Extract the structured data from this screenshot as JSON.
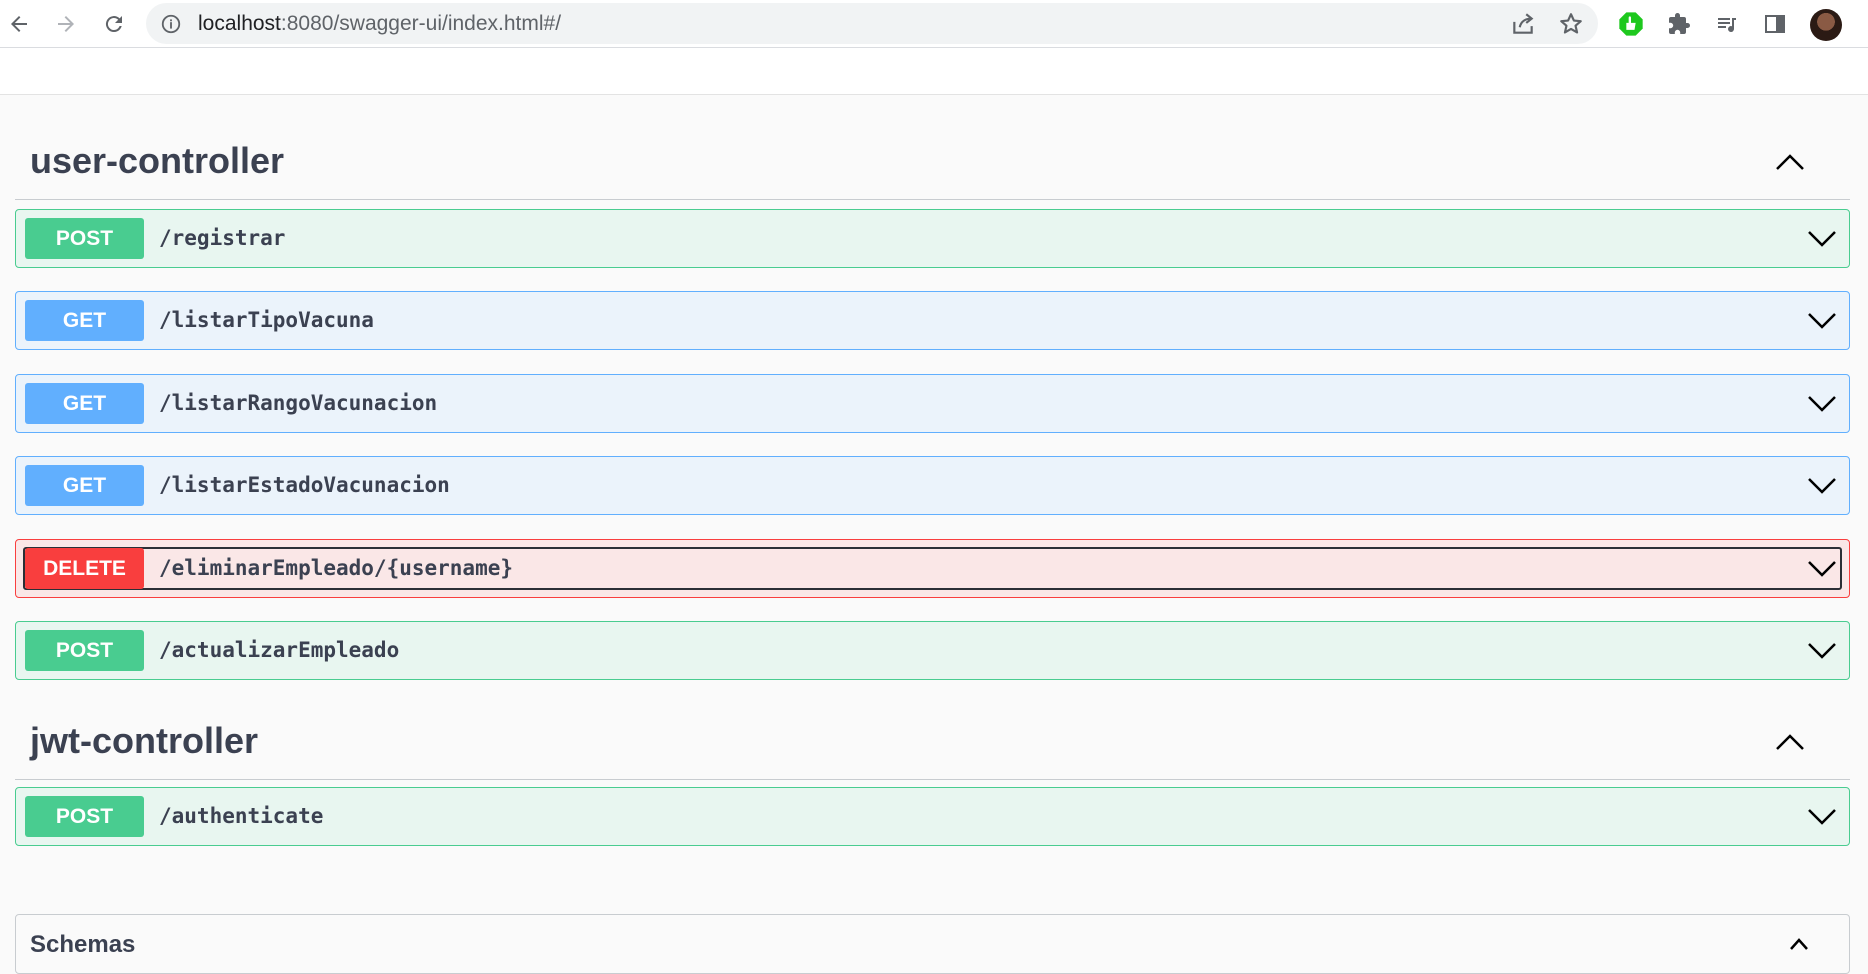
{
  "browser": {
    "url_host": "localhost",
    "url_rest": ":8080/swagger-ui/index.html#/"
  },
  "colors": {
    "post": "#49cc90",
    "get": "#61affe",
    "delete": "#f93e3e",
    "text": "#3b4151"
  },
  "tags": [
    {
      "name": "user-controller",
      "operations": [
        {
          "method": "POST",
          "path": "/registrar"
        },
        {
          "method": "GET",
          "path": "/listarTipoVacuna"
        },
        {
          "method": "GET",
          "path": "/listarRangoVacunacion"
        },
        {
          "method": "GET",
          "path": "/listarEstadoVacunacion"
        },
        {
          "method": "DELETE",
          "path": "/eliminarEmpleado/{username}"
        },
        {
          "method": "POST",
          "path": "/actualizarEmpleado"
        }
      ]
    },
    {
      "name": "jwt-controller",
      "operations": [
        {
          "method": "POST",
          "path": "/authenticate"
        }
      ]
    }
  ],
  "schemas": {
    "title": "Schemas"
  }
}
